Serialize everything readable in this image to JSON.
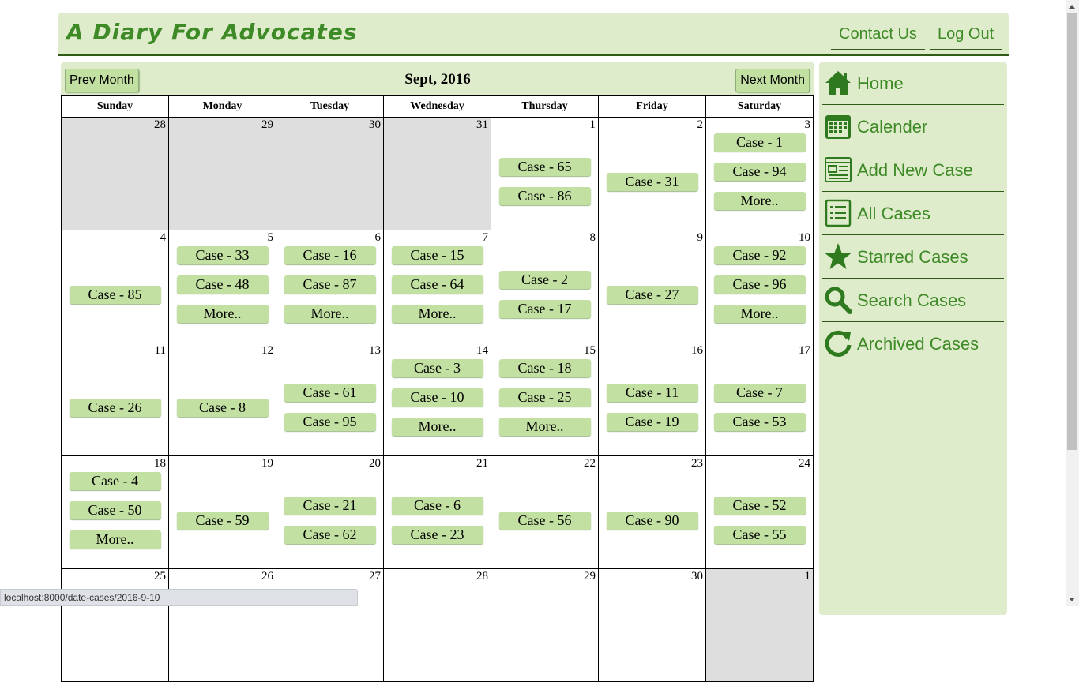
{
  "header": {
    "brand": "A Diary For Advocates",
    "contact_label": "Contact Us",
    "logout_label": "Log Out"
  },
  "calendar": {
    "prev_label": "Prev Month",
    "next_label": "Next Month",
    "month_title": "Sept, 2016",
    "weekdays": [
      "Sunday",
      "Monday",
      "Tuesday",
      "Wednesday",
      "Thursday",
      "Friday",
      "Saturday"
    ],
    "weeks": [
      [
        {
          "day": "28",
          "out": true,
          "cases": []
        },
        {
          "day": "29",
          "out": true,
          "cases": []
        },
        {
          "day": "30",
          "out": true,
          "cases": []
        },
        {
          "day": "31",
          "out": true,
          "cases": []
        },
        {
          "day": "1",
          "out": false,
          "cases": [
            "Case - 65",
            "Case - 86"
          ]
        },
        {
          "day": "2",
          "out": false,
          "cases": [
            "Case - 31"
          ]
        },
        {
          "day": "3",
          "out": false,
          "cases": [
            "Case - 1",
            "Case - 94",
            "More.."
          ]
        }
      ],
      [
        {
          "day": "4",
          "out": false,
          "cases": [
            "Case - 85"
          ]
        },
        {
          "day": "5",
          "out": false,
          "cases": [
            "Case - 33",
            "Case - 48",
            "More.."
          ]
        },
        {
          "day": "6",
          "out": false,
          "cases": [
            "Case - 16",
            "Case - 87",
            "More.."
          ]
        },
        {
          "day": "7",
          "out": false,
          "cases": [
            "Case - 15",
            "Case - 64",
            "More.."
          ]
        },
        {
          "day": "8",
          "out": false,
          "cases": [
            "Case - 2",
            "Case - 17"
          ]
        },
        {
          "day": "9",
          "out": false,
          "cases": [
            "Case - 27"
          ]
        },
        {
          "day": "10",
          "out": false,
          "cases": [
            "Case - 92",
            "Case - 96",
            "More.."
          ]
        }
      ],
      [
        {
          "day": "11",
          "out": false,
          "cases": [
            "Case - 26"
          ]
        },
        {
          "day": "12",
          "out": false,
          "cases": [
            "Case - 8"
          ]
        },
        {
          "day": "13",
          "out": false,
          "cases": [
            "Case - 61",
            "Case - 95"
          ]
        },
        {
          "day": "14",
          "out": false,
          "cases": [
            "Case - 3",
            "Case - 10",
            "More.."
          ]
        },
        {
          "day": "15",
          "out": false,
          "cases": [
            "Case - 18",
            "Case - 25",
            "More.."
          ]
        },
        {
          "day": "16",
          "out": false,
          "cases": [
            "Case - 11",
            "Case - 19"
          ]
        },
        {
          "day": "17",
          "out": false,
          "cases": [
            "Case - 7",
            "Case - 53"
          ]
        }
      ],
      [
        {
          "day": "18",
          "out": false,
          "cases": [
            "Case - 4",
            "Case - 50",
            "More.."
          ]
        },
        {
          "day": "19",
          "out": false,
          "cases": [
            "Case - 59"
          ]
        },
        {
          "day": "20",
          "out": false,
          "cases": [
            "Case - 21",
            "Case - 62"
          ]
        },
        {
          "day": "21",
          "out": false,
          "cases": [
            "Case - 6",
            "Case - 23"
          ]
        },
        {
          "day": "22",
          "out": false,
          "cases": [
            "Case - 56"
          ]
        },
        {
          "day": "23",
          "out": false,
          "cases": [
            "Case - 90"
          ]
        },
        {
          "day": "24",
          "out": false,
          "cases": [
            "Case - 52",
            "Case - 55"
          ]
        }
      ],
      [
        {
          "day": "25",
          "out": false,
          "cases": []
        },
        {
          "day": "26",
          "out": false,
          "cases": []
        },
        {
          "day": "27",
          "out": false,
          "cases": []
        },
        {
          "day": "28",
          "out": false,
          "cases": []
        },
        {
          "day": "29",
          "out": false,
          "cases": []
        },
        {
          "day": "30",
          "out": false,
          "cases": []
        },
        {
          "day": "1",
          "out": true,
          "cases": []
        }
      ]
    ]
  },
  "sidebar": {
    "items": [
      {
        "label": "Home",
        "icon": "home-icon"
      },
      {
        "label": "Calender",
        "icon": "calendar-icon"
      },
      {
        "label": "Add New Case",
        "icon": "form-icon"
      },
      {
        "label": "All Cases",
        "icon": "list-icon"
      },
      {
        "label": "Starred Cases",
        "icon": "star-icon"
      },
      {
        "label": "Search Cases",
        "icon": "search-icon"
      },
      {
        "label": "Archived Cases",
        "icon": "refresh-icon"
      }
    ]
  },
  "status_url": "localhost:8000/date-cases/2016-9-10",
  "colors": {
    "panel_bg": "#dfeccb",
    "accent": "#3d8a26",
    "case_bg": "#c3e0a3",
    "out_of_month": "#dedede"
  }
}
